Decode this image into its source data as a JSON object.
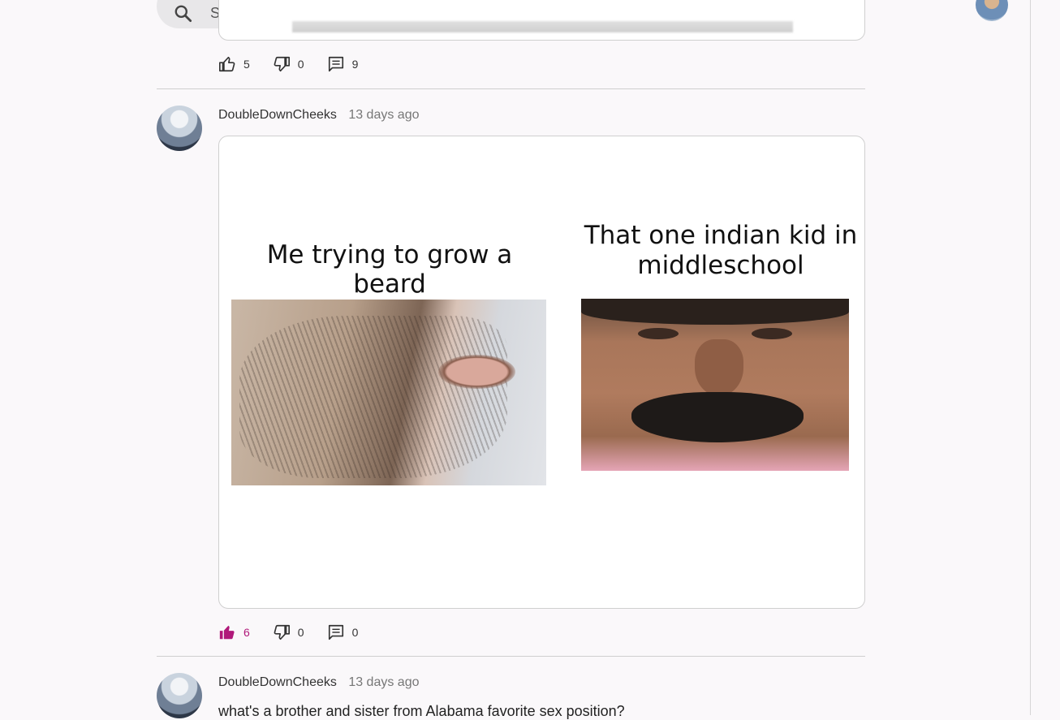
{
  "search": {
    "placeholder": "Search"
  },
  "previous_post": {
    "likes": "5",
    "dislikes": "0",
    "comments": "9"
  },
  "post": {
    "username": "DoubleDownCheeks",
    "time": "13 days ago",
    "meme": {
      "left_caption": "Me trying to grow a beard",
      "right_caption": "That one indian kid in middleschool"
    },
    "likes": "6",
    "dislikes": "0",
    "comments": "0",
    "liked": true
  },
  "next_post": {
    "username": "DoubleDownCheeks",
    "time": "13 days ago",
    "text": "what's a brother and sister from Alabama favorite sex position?"
  },
  "colors": {
    "accent": "#b0197a",
    "background": "#faf8fa",
    "search_bg": "#e8e7e9"
  }
}
